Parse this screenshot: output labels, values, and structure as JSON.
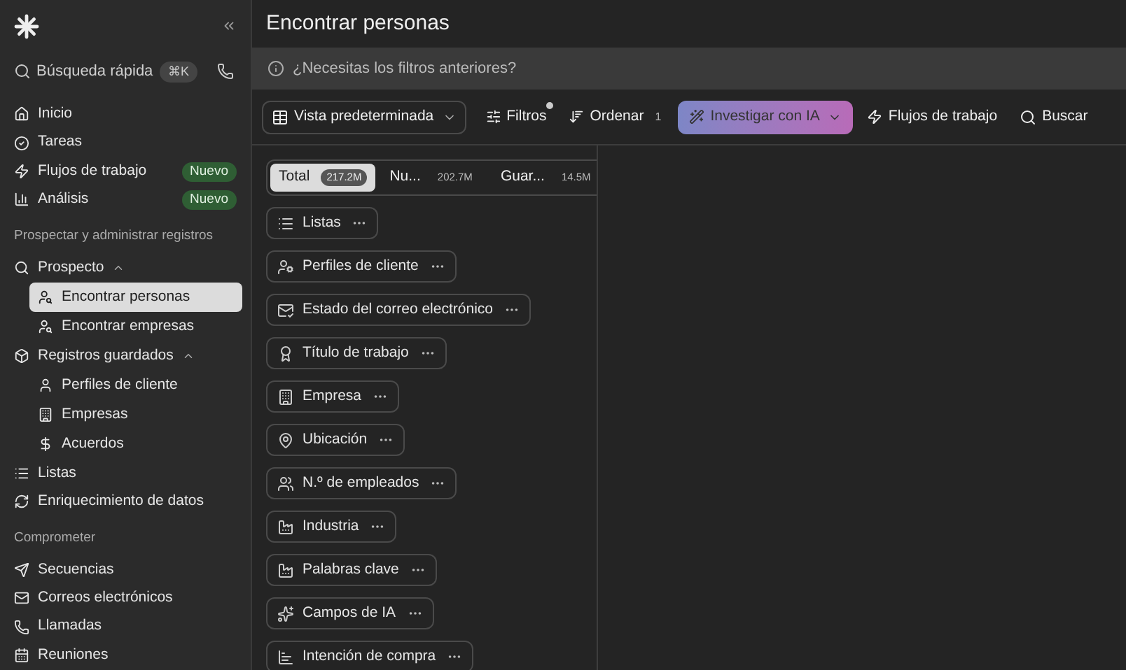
{
  "sidebar": {
    "quick_search": {
      "placeholder": "Búsqueda rápida",
      "shortcut": "⌘K"
    },
    "items": [
      {
        "kind": "link",
        "label": "Inicio",
        "selected": false
      },
      {
        "kind": "link",
        "label": "Tareas",
        "selected": false
      },
      {
        "kind": "link",
        "label": "Flujos de trabajo",
        "badge": "Nuevo",
        "selected": false
      },
      {
        "kind": "link",
        "label": "Análisis",
        "badge": "Nuevo",
        "selected": false
      },
      {
        "kind": "heading",
        "label": "Prospectar y administrar registros"
      },
      {
        "kind": "parent",
        "label": "Prospecto",
        "expanded": true,
        "children": [
          {
            "label": "Encontrar personas",
            "selected": true
          },
          {
            "label": "Encontrar empresas",
            "selected": false
          }
        ]
      },
      {
        "kind": "parent",
        "label": "Registros guardados",
        "expanded": true,
        "children": [
          {
            "label": "Perfiles de cliente",
            "selected": false
          },
          {
            "label": "Empresas",
            "selected": false
          },
          {
            "label": "Acuerdos",
            "selected": false
          }
        ]
      },
      {
        "kind": "link",
        "label": "Listas",
        "selected": false
      },
      {
        "kind": "link",
        "label": "Enriquecimiento de datos",
        "selected": false
      },
      {
        "kind": "heading",
        "label": "Comprometer"
      },
      {
        "kind": "link",
        "label": "Secuencias",
        "selected": false
      },
      {
        "kind": "link",
        "label": "Correos electrónicos",
        "selected": false
      },
      {
        "kind": "link",
        "label": "Llamadas",
        "selected": false
      },
      {
        "kind": "link",
        "label": "Reuniones",
        "selected": false
      }
    ]
  },
  "page": {
    "title": "Encontrar personas",
    "banner": "¿Necesitas los filtros anteriores?"
  },
  "toolbar": {
    "view": "Vista predeterminada",
    "filters": {
      "label": "Filtros",
      "indicator": true
    },
    "sort": {
      "label": "Ordenar",
      "count": "1"
    },
    "ai": "Investigar con IA",
    "workflows": "Flujos de trabajo",
    "search": "Buscar"
  },
  "segments": [
    {
      "label": "Total",
      "count": "217.2M",
      "selected": true
    },
    {
      "label": "Nu...",
      "count": "202.7M",
      "selected": false
    },
    {
      "label": "Guar...",
      "count": "14.5M",
      "selected": false
    }
  ],
  "filters": [
    "Listas",
    "Perfiles de cliente",
    "Estado del correo electrónico",
    "Título de trabajo",
    "Empresa",
    "Ubicación",
    "N.º de empleados",
    "Industria",
    "Palabras clave",
    "Campos de IA",
    "Intención de compra"
  ]
}
